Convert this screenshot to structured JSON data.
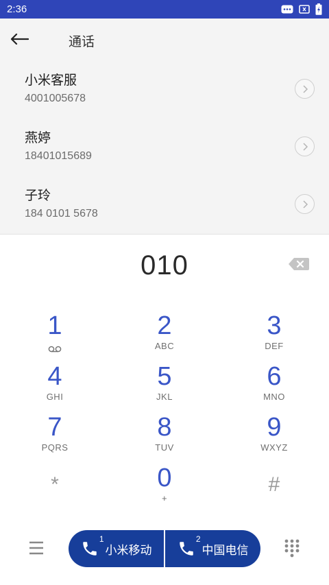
{
  "status_bar": {
    "time": "2:36",
    "icons": [
      "message-icon",
      "sim-card-icon",
      "battery-charging-icon"
    ]
  },
  "header": {
    "title": "通话",
    "back_icon": "arrow-left-icon"
  },
  "suggestions": [
    {
      "name": "小米客服",
      "number": "4001005678"
    },
    {
      "name": "燕婷",
      "number": "18401015689"
    },
    {
      "name": "子玲",
      "number": "184 0101 5678"
    }
  ],
  "dial": {
    "digits": "010"
  },
  "keypad": [
    {
      "num": "1",
      "letters": ""
    },
    {
      "num": "2",
      "letters": "ABC"
    },
    {
      "num": "3",
      "letters": "DEF"
    },
    {
      "num": "4",
      "letters": "GHI"
    },
    {
      "num": "5",
      "letters": "JKL"
    },
    {
      "num": "6",
      "letters": "MNO"
    },
    {
      "num": "7",
      "letters": "PQRS"
    },
    {
      "num": "8",
      "letters": "TUV"
    },
    {
      "num": "9",
      "letters": "WXYZ"
    },
    {
      "num": "*",
      "letters": ""
    },
    {
      "num": "0",
      "letters": "+"
    },
    {
      "num": "#",
      "letters": ""
    }
  ],
  "bottom": {
    "call_sim1": {
      "sim": "1",
      "label": "小米移动"
    },
    "call_sim2": {
      "sim": "2",
      "label": "中国电信"
    }
  },
  "colors": {
    "status_bar": "#2f45b8",
    "accent": "#3a56c7",
    "call_button": "#173e9a"
  }
}
